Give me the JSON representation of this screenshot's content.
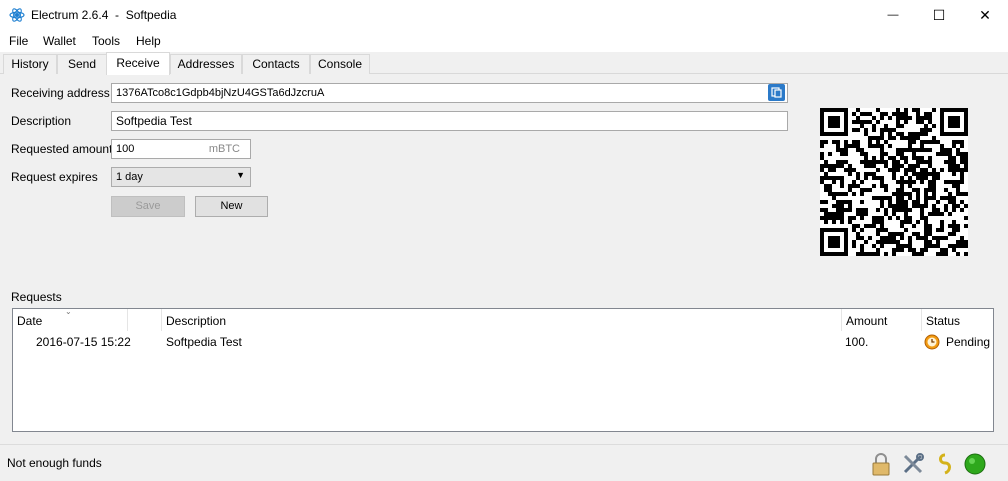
{
  "window": {
    "title": "Electrum 2.6.4  -  Softpedia",
    "minimize_glyph": "—",
    "maximize_glyph": "☐",
    "close_glyph": "✕"
  },
  "menu": [
    "File",
    "Wallet",
    "Tools",
    "Help"
  ],
  "tabs": [
    "History",
    "Send",
    "Receive",
    "Addresses",
    "Contacts",
    "Console"
  ],
  "active_tab": "Receive",
  "receive": {
    "receiving_address_label": "Receiving address",
    "receiving_address": "1376ATco8c1Gdpb4bjNzU4GSTa6dJzcruA",
    "description_label": "Description",
    "description": "Softpedia Test",
    "requested_amount_label": "Requested amount",
    "requested_amount": "100",
    "amount_unit": "mBTC",
    "request_expires_label": "Request expires",
    "request_expires": "1 day",
    "save_label": "Save",
    "new_label": "New"
  },
  "requests": {
    "title": "Requests",
    "columns": [
      "Date",
      "Description",
      "Amount",
      "Status"
    ],
    "rows": [
      {
        "date": "2016-07-15 15:22",
        "description": "Softpedia Test",
        "amount": "100.",
        "status": "Pending"
      }
    ]
  },
  "status": {
    "message": "Not enough funds",
    "online_color": "#2ea81c"
  },
  "colors": {
    "qr_dark": "#000000",
    "icon_blue": "#2b7ac9"
  }
}
